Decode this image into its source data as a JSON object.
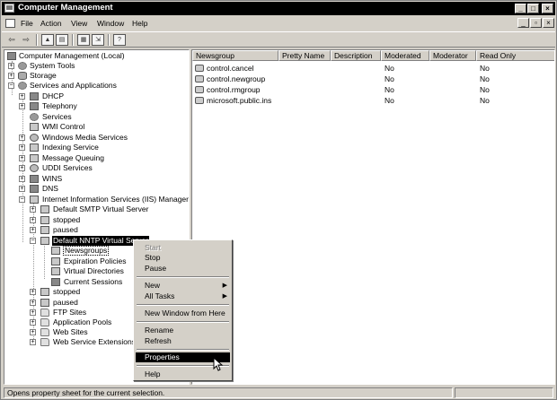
{
  "window": {
    "title": "Computer Management"
  },
  "menu": [
    "File",
    "Action",
    "View",
    "Window",
    "Help"
  ],
  "tree": [
    {
      "label": "Computer Management (Local)"
    },
    {
      "label": "System Tools"
    },
    {
      "label": "Storage"
    },
    {
      "label": "Services and Applications"
    },
    {
      "label": "DHCP"
    },
    {
      "label": "Telephony"
    },
    {
      "label": "Services"
    },
    {
      "label": "WMI Control"
    },
    {
      "label": "Windows Media Services"
    },
    {
      "label": "Indexing Service"
    },
    {
      "label": "Message Queuing"
    },
    {
      "label": "UDDI Services"
    },
    {
      "label": "WINS"
    },
    {
      "label": "DNS"
    },
    {
      "label": "Internet Information Services (IIS) Manager"
    },
    {
      "label": "Default SMTP Virtual Server"
    },
    {
      "label": "stopped"
    },
    {
      "label": "paused"
    },
    {
      "label": "Default NNTP Virtual Server"
    },
    {
      "label": "Newsgroups"
    },
    {
      "label": "Expiration Policies"
    },
    {
      "label": "Virtual Directories"
    },
    {
      "label": "Current Sessions"
    },
    {
      "label": "stopped"
    },
    {
      "label": "paused"
    },
    {
      "label": "FTP Sites"
    },
    {
      "label": "Application Pools"
    },
    {
      "label": "Web Sites"
    },
    {
      "label": "Web Service Extensions"
    }
  ],
  "list": {
    "columns": [
      "Newsgroup",
      "Pretty Name",
      "Description",
      "Moderated",
      "Moderator",
      "Read Only"
    ],
    "rows": [
      {
        "newsgroup": "control.cancel",
        "pretty": "",
        "description": "",
        "moderated": "No",
        "moderator": "",
        "readonly": "No"
      },
      {
        "newsgroup": "control.newgroup",
        "pretty": "",
        "description": "",
        "moderated": "No",
        "moderator": "",
        "readonly": "No"
      },
      {
        "newsgroup": "control.rmgroup",
        "pretty": "",
        "description": "",
        "moderated": "No",
        "moderator": "",
        "readonly": "No"
      },
      {
        "newsgroup": "microsoft.public.ins",
        "pretty": "",
        "description": "",
        "moderated": "No",
        "moderator": "",
        "readonly": "No"
      }
    ]
  },
  "context_menu": [
    {
      "label": "Start",
      "disabled": true
    },
    {
      "label": "Stop"
    },
    {
      "label": "Pause"
    },
    {
      "label": "New",
      "submenu": true
    },
    {
      "label": "All Tasks",
      "submenu": true
    },
    {
      "label": "New Window from Here"
    },
    {
      "label": "Rename"
    },
    {
      "label": "Refresh"
    },
    {
      "label": "Properties",
      "highlighted": true
    },
    {
      "label": "Help"
    }
  ],
  "statusbar": {
    "text": "Opens property sheet for the current selection."
  }
}
